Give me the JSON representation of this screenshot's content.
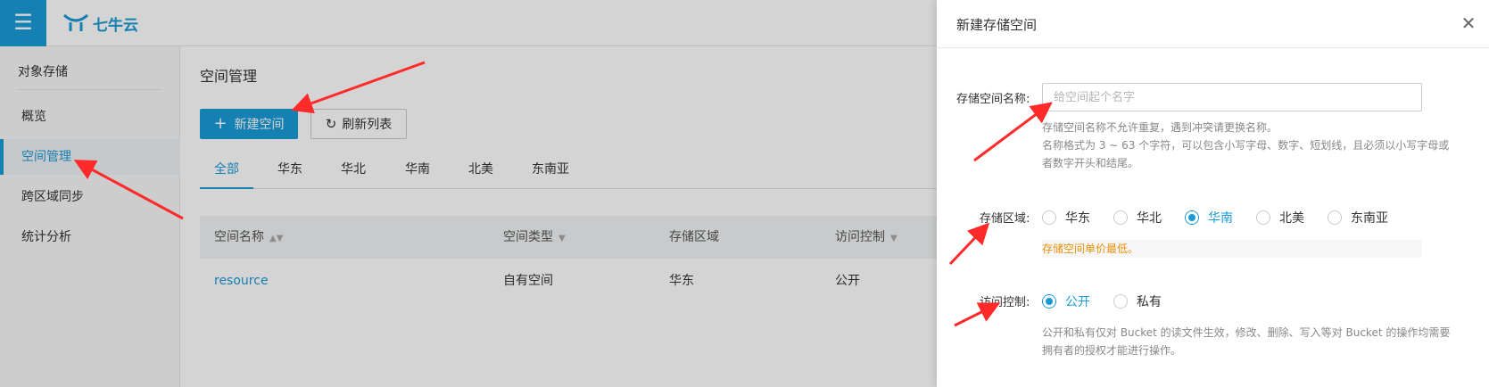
{
  "header": {
    "menu_icon": "☰",
    "logo_text": "七牛云"
  },
  "sidebar": {
    "title": "对象存储",
    "items": [
      {
        "label": "概览"
      },
      {
        "label": "空间管理"
      },
      {
        "label": "跨区域同步"
      },
      {
        "label": "统计分析"
      }
    ]
  },
  "main": {
    "title": "空间管理",
    "new_bucket_button": "新建空间",
    "refresh_button": "刷新列表",
    "region_tabs": [
      "全部",
      "华东",
      "华北",
      "华南",
      "北美",
      "东南亚"
    ],
    "table": {
      "headers": [
        "空间名称",
        "空间类型",
        "存储区域",
        "访问控制"
      ],
      "rows": [
        [
          "resource",
          "自有空间",
          "华东",
          "公开"
        ]
      ]
    }
  },
  "panel": {
    "title": "新建存储空间",
    "name_label": "存储空间名称:",
    "name_placeholder": "给空间起个名字",
    "name_value": "",
    "name_hint_1": "存储空间名称不允许重复，遇到冲突请更换名称。",
    "name_hint_2": "名称格式为 3 ~ 63 个字符，可以包含小写字母、数字、短划线，且必须以小写字母或",
    "name_hint_3": "者数字开头和结尾。",
    "region_label": "存储区域:",
    "regions": [
      "华东",
      "华北",
      "华南",
      "北美",
      "东南亚"
    ],
    "region_selected": "华南",
    "region_note": "存储空间单价最低。",
    "access_label": "访问控制:",
    "access_options": [
      "公开",
      "私有"
    ],
    "access_selected": "公开",
    "access_hint_1": "公开和私有仅对 Bucket 的读文件生效，修改、删除、写入等对 Bucket 的操作均需要",
    "access_hint_2": "拥有者的授权才能进行操作。"
  },
  "colors": {
    "accent": "#1a9ad6",
    "annotation": "#ff2a2a",
    "price_note": "#e8900c"
  }
}
